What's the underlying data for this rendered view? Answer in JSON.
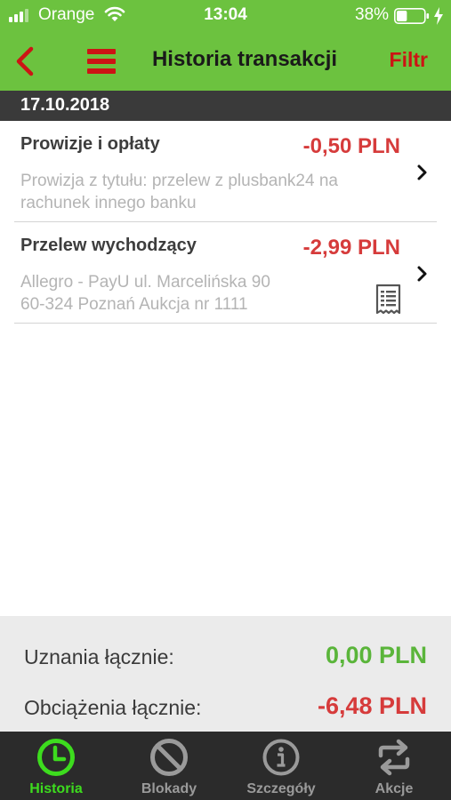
{
  "status_bar": {
    "carrier": "Orange",
    "time": "13:04",
    "battery_percent": "38%",
    "battery_level": 0.38
  },
  "nav": {
    "title": "Historia transakcji",
    "filter_label": "Filtr",
    "back_icon": "chevron-left-icon",
    "menu_icon": "hamburger-menu-icon"
  },
  "date_header": "17.10.2018",
  "transactions": [
    {
      "title": "Prowizje i opłaty",
      "amount": "-0,50 PLN",
      "description": "Prowizja z tytułu: przelew z plusbank24 na rachunek innego banku",
      "desc_lines": [
        "Prowizja z tytułu: przelew z plusbank24 na",
        "rachunek innego banku"
      ]
    },
    {
      "title": "Przelew wychodzący",
      "amount": "-2,99 PLN",
      "description": "Allegro - PayU ul. Marcelińska 90 60-324 Poznań  Aukcja nr 1111",
      "desc_lines": [
        "Allegro - PayU ul. Marcelińska 90",
        "60-324 Poznań  Aukcja nr 1111"
      ],
      "has_receipt": true
    }
  ],
  "totals": {
    "credits_label": "Uznania łącznie:",
    "credits_value": "0,00 PLN",
    "debits_label": "Obciążenia łącznie:",
    "debits_value": "-6,48 PLN"
  },
  "tabs": [
    {
      "label": "Historia",
      "icon": "clock-icon",
      "active": true
    },
    {
      "label": "Blokady",
      "icon": "blocked-icon",
      "active": false
    },
    {
      "label": "Szczegóły",
      "icon": "info-icon",
      "active": false
    },
    {
      "label": "Akcje",
      "icon": "swap-arrows-icon",
      "active": false
    }
  ],
  "colors": {
    "header_green": "#6cc23f",
    "accent_red": "#cc1414",
    "amount_red": "#d63b3b",
    "positive_green": "#5ab53a",
    "active_tab_green": "#3ddc1e",
    "tab_bar_bg": "#2b2b2b",
    "date_header_bg": "#3a3a3a"
  }
}
